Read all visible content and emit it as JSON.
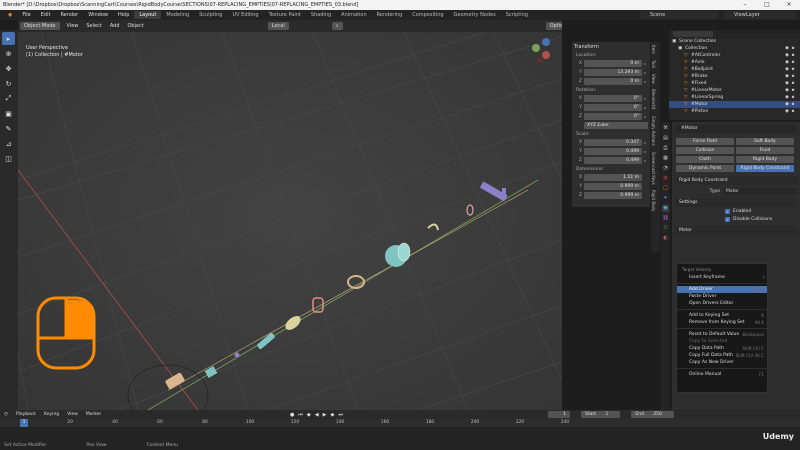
{
  "window": {
    "title": "Blender* [D:\\Dropbox\\Dropbox\\ScanningCart\\Courses\\RigidBodyCourse\\SECTIONS\\07-REPLACING_EMPTIES\\07-REPLACING_EMPTIES_03.blend]",
    "minimize": "–",
    "maximize": "□",
    "close": "✕"
  },
  "menubar": {
    "items": [
      "File",
      "Edit",
      "Render",
      "Window",
      "Help"
    ],
    "workspaces": [
      "Layout",
      "Modeling",
      "Sculpting",
      "UV Editing",
      "Texture Paint",
      "Shading",
      "Animation",
      "Rendering",
      "Compositing",
      "Geometry Nodes",
      "Scripting"
    ],
    "active_workspace": "Layout",
    "scene": "Scene",
    "view_layer": "ViewLayer"
  },
  "viewport": {
    "mode": "Object Mode",
    "menus": [
      "View",
      "Select",
      "Add",
      "Object"
    ],
    "orientation": "Local",
    "options": "Options",
    "overlay_line1": "User Perspective",
    "overlay_line2": "(1) Collection | #Motor"
  },
  "npanel": {
    "header": "Transform",
    "location_label": "Location:",
    "location": [
      {
        "axis": "X",
        "value": "0 m"
      },
      {
        "axis": "Y",
        "value": "13.293 m"
      },
      {
        "axis": "Z",
        "value": "0 m"
      }
    ],
    "rotation_label": "Rotation:",
    "rotation": [
      {
        "axis": "X",
        "value": "0°"
      },
      {
        "axis": "Y",
        "value": "0°"
      },
      {
        "axis": "Z",
        "value": "0°"
      }
    ],
    "rotation_mode": "XYZ Euler",
    "scale_label": "Scale:",
    "scale": [
      {
        "axis": "X",
        "value": "0.347"
      },
      {
        "axis": "Y",
        "value": "0.499"
      },
      {
        "axis": "Z",
        "value": "0.499"
      }
    ],
    "dimensions_label": "Dimensions:",
    "dimensions": [
      {
        "axis": "X",
        "value": "1.11 m"
      },
      {
        "axis": "Y",
        "value": "0.999 m"
      },
      {
        "axis": "Z",
        "value": "0.999 m"
      }
    ],
    "tabs": [
      "Item",
      "Tool",
      "View",
      "Blenderkit",
      "Simply Addons",
      "Screencast Keys",
      "Rigid Body"
    ]
  },
  "outliner": {
    "rows": [
      {
        "name": "Scene Collection",
        "indent": 0,
        "selected": false
      },
      {
        "name": "Collection",
        "indent": 1,
        "selected": false
      },
      {
        "name": "#AtControler",
        "indent": 2,
        "selected": false
      },
      {
        "name": "#Axle",
        "indent": 2,
        "selected": false
      },
      {
        "name": "#Balljoint",
        "indent": 2,
        "selected": false
      },
      {
        "name": "#Brake",
        "indent": 2,
        "selected": false
      },
      {
        "name": "#Fixed",
        "indent": 2,
        "selected": false
      },
      {
        "name": "#LinearMotor",
        "indent": 2,
        "selected": false
      },
      {
        "name": "#LinearSpring",
        "indent": 2,
        "selected": false
      },
      {
        "name": "#Motor",
        "indent": 2,
        "selected": true
      },
      {
        "name": "#Piston",
        "indent": 2,
        "selected": false
      }
    ]
  },
  "properties": {
    "object_name": "#Motor",
    "physics_buttons": [
      {
        "label": "Force Field",
        "on": false
      },
      {
        "label": "Soft Body",
        "on": false
      },
      {
        "label": "Collision",
        "on": false
      },
      {
        "label": "Fluid",
        "on": false
      },
      {
        "label": "Cloth",
        "on": false
      },
      {
        "label": "Rigid Body",
        "on": false
      },
      {
        "label": "Dynamic Paint",
        "on": false
      },
      {
        "label": "Rigid Body Constraint",
        "on": true
      }
    ],
    "rbc_section": "Rigid Body Constraint",
    "type_label": "Type",
    "type_value": "Motor",
    "settings_section": "Settings",
    "enabled": "Enabled",
    "disable_collisions": "Disable Collisions",
    "motor_section": "Motor"
  },
  "context_menu": {
    "title": "Target Velocity",
    "items": [
      {
        "label": "Insert Keyframe",
        "shortcut": "I",
        "state": "normal"
      },
      {
        "sep": true
      },
      {
        "label": "Add Driver",
        "shortcut": "Ctrl D",
        "state": "highlight"
      },
      {
        "label": "Paste Driver",
        "shortcut": "",
        "state": "normal"
      },
      {
        "label": "Open Drivers Editor",
        "shortcut": "",
        "state": "normal"
      },
      {
        "sep": true
      },
      {
        "label": "Add to Keying Set",
        "shortcut": "K",
        "state": "normal"
      },
      {
        "label": "Remove from Keying Set",
        "shortcut": "Alt K",
        "state": "normal"
      },
      {
        "sep": true
      },
      {
        "label": "Reset to Default Value",
        "shortcut": "Backspace",
        "state": "normal"
      },
      {
        "label": "Copy to Selected",
        "shortcut": "",
        "state": "disabled"
      },
      {
        "label": "Copy Data Path",
        "shortcut": "Shift Ctrl C",
        "state": "normal"
      },
      {
        "label": "Copy Full Data Path",
        "shortcut": "Shift Ctrl Alt C",
        "state": "normal"
      },
      {
        "label": "Copy As New Driver",
        "shortcut": "",
        "state": "normal"
      },
      {
        "sep": true
      },
      {
        "label": "Online Manual",
        "shortcut": "F1",
        "state": "normal"
      }
    ]
  },
  "timeline": {
    "menus": [
      "Playback",
      "Keying",
      "View",
      "Marker"
    ],
    "start_label": "Start",
    "start": "1",
    "end_label": "End",
    "end": "250",
    "current": "1",
    "ticks": [
      "20",
      "40",
      "60",
      "80",
      "100",
      "120",
      "140",
      "160",
      "180",
      "200",
      "220",
      "240"
    ]
  },
  "statusbar": {
    "items": [
      "Set Active Modifier",
      "Pan View",
      "Context Menu"
    ]
  },
  "watermark": "Udemy",
  "colors": {
    "accent": "#4772b3",
    "orange": "#ff8c00",
    "object_tan": "#d9b48c",
    "object_teal": "#7fc4c0",
    "object_purple": "#8c80c8",
    "axis_green": "#7aa05a",
    "axis_red": "#b05050"
  }
}
